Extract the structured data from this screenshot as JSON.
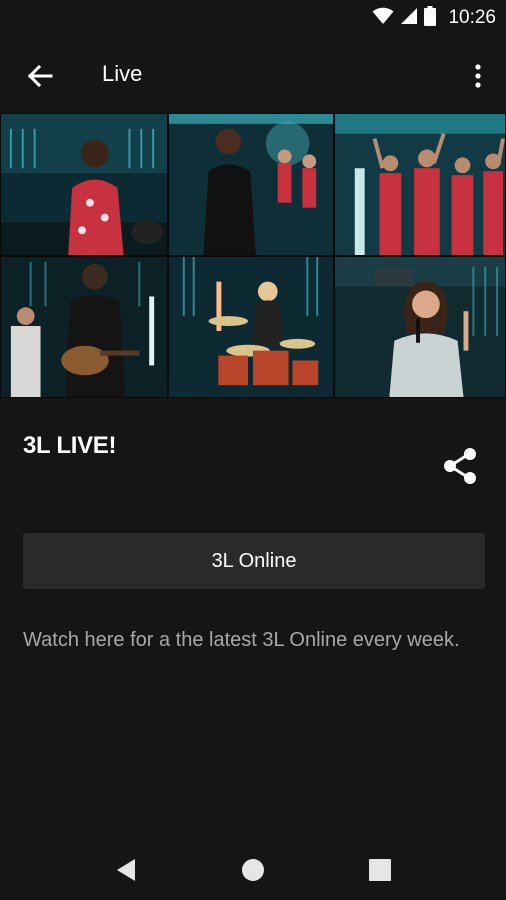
{
  "status_bar": {
    "time": "10:26",
    "icons": [
      "wifi-icon",
      "signal-icon",
      "battery-icon"
    ]
  },
  "app_bar": {
    "title": "Live",
    "back_icon": "arrow-left-icon",
    "menu_icon": "more-vertical-icon"
  },
  "content": {
    "title": "3L LIVE!",
    "share_icon": "share-icon",
    "button_label": "3L Online",
    "description": "Watch here for a the latest 3L Online every week."
  },
  "nav_bar": {
    "icons": [
      "back-triangle-icon",
      "home-circle-icon",
      "recents-square-icon"
    ]
  },
  "colors": {
    "background": "#151515",
    "button_bg": "#2a2a2a",
    "description_text": "#a8a8a8",
    "stage_teal": "#2bb7c2",
    "shirt_red": "#c8323f"
  }
}
